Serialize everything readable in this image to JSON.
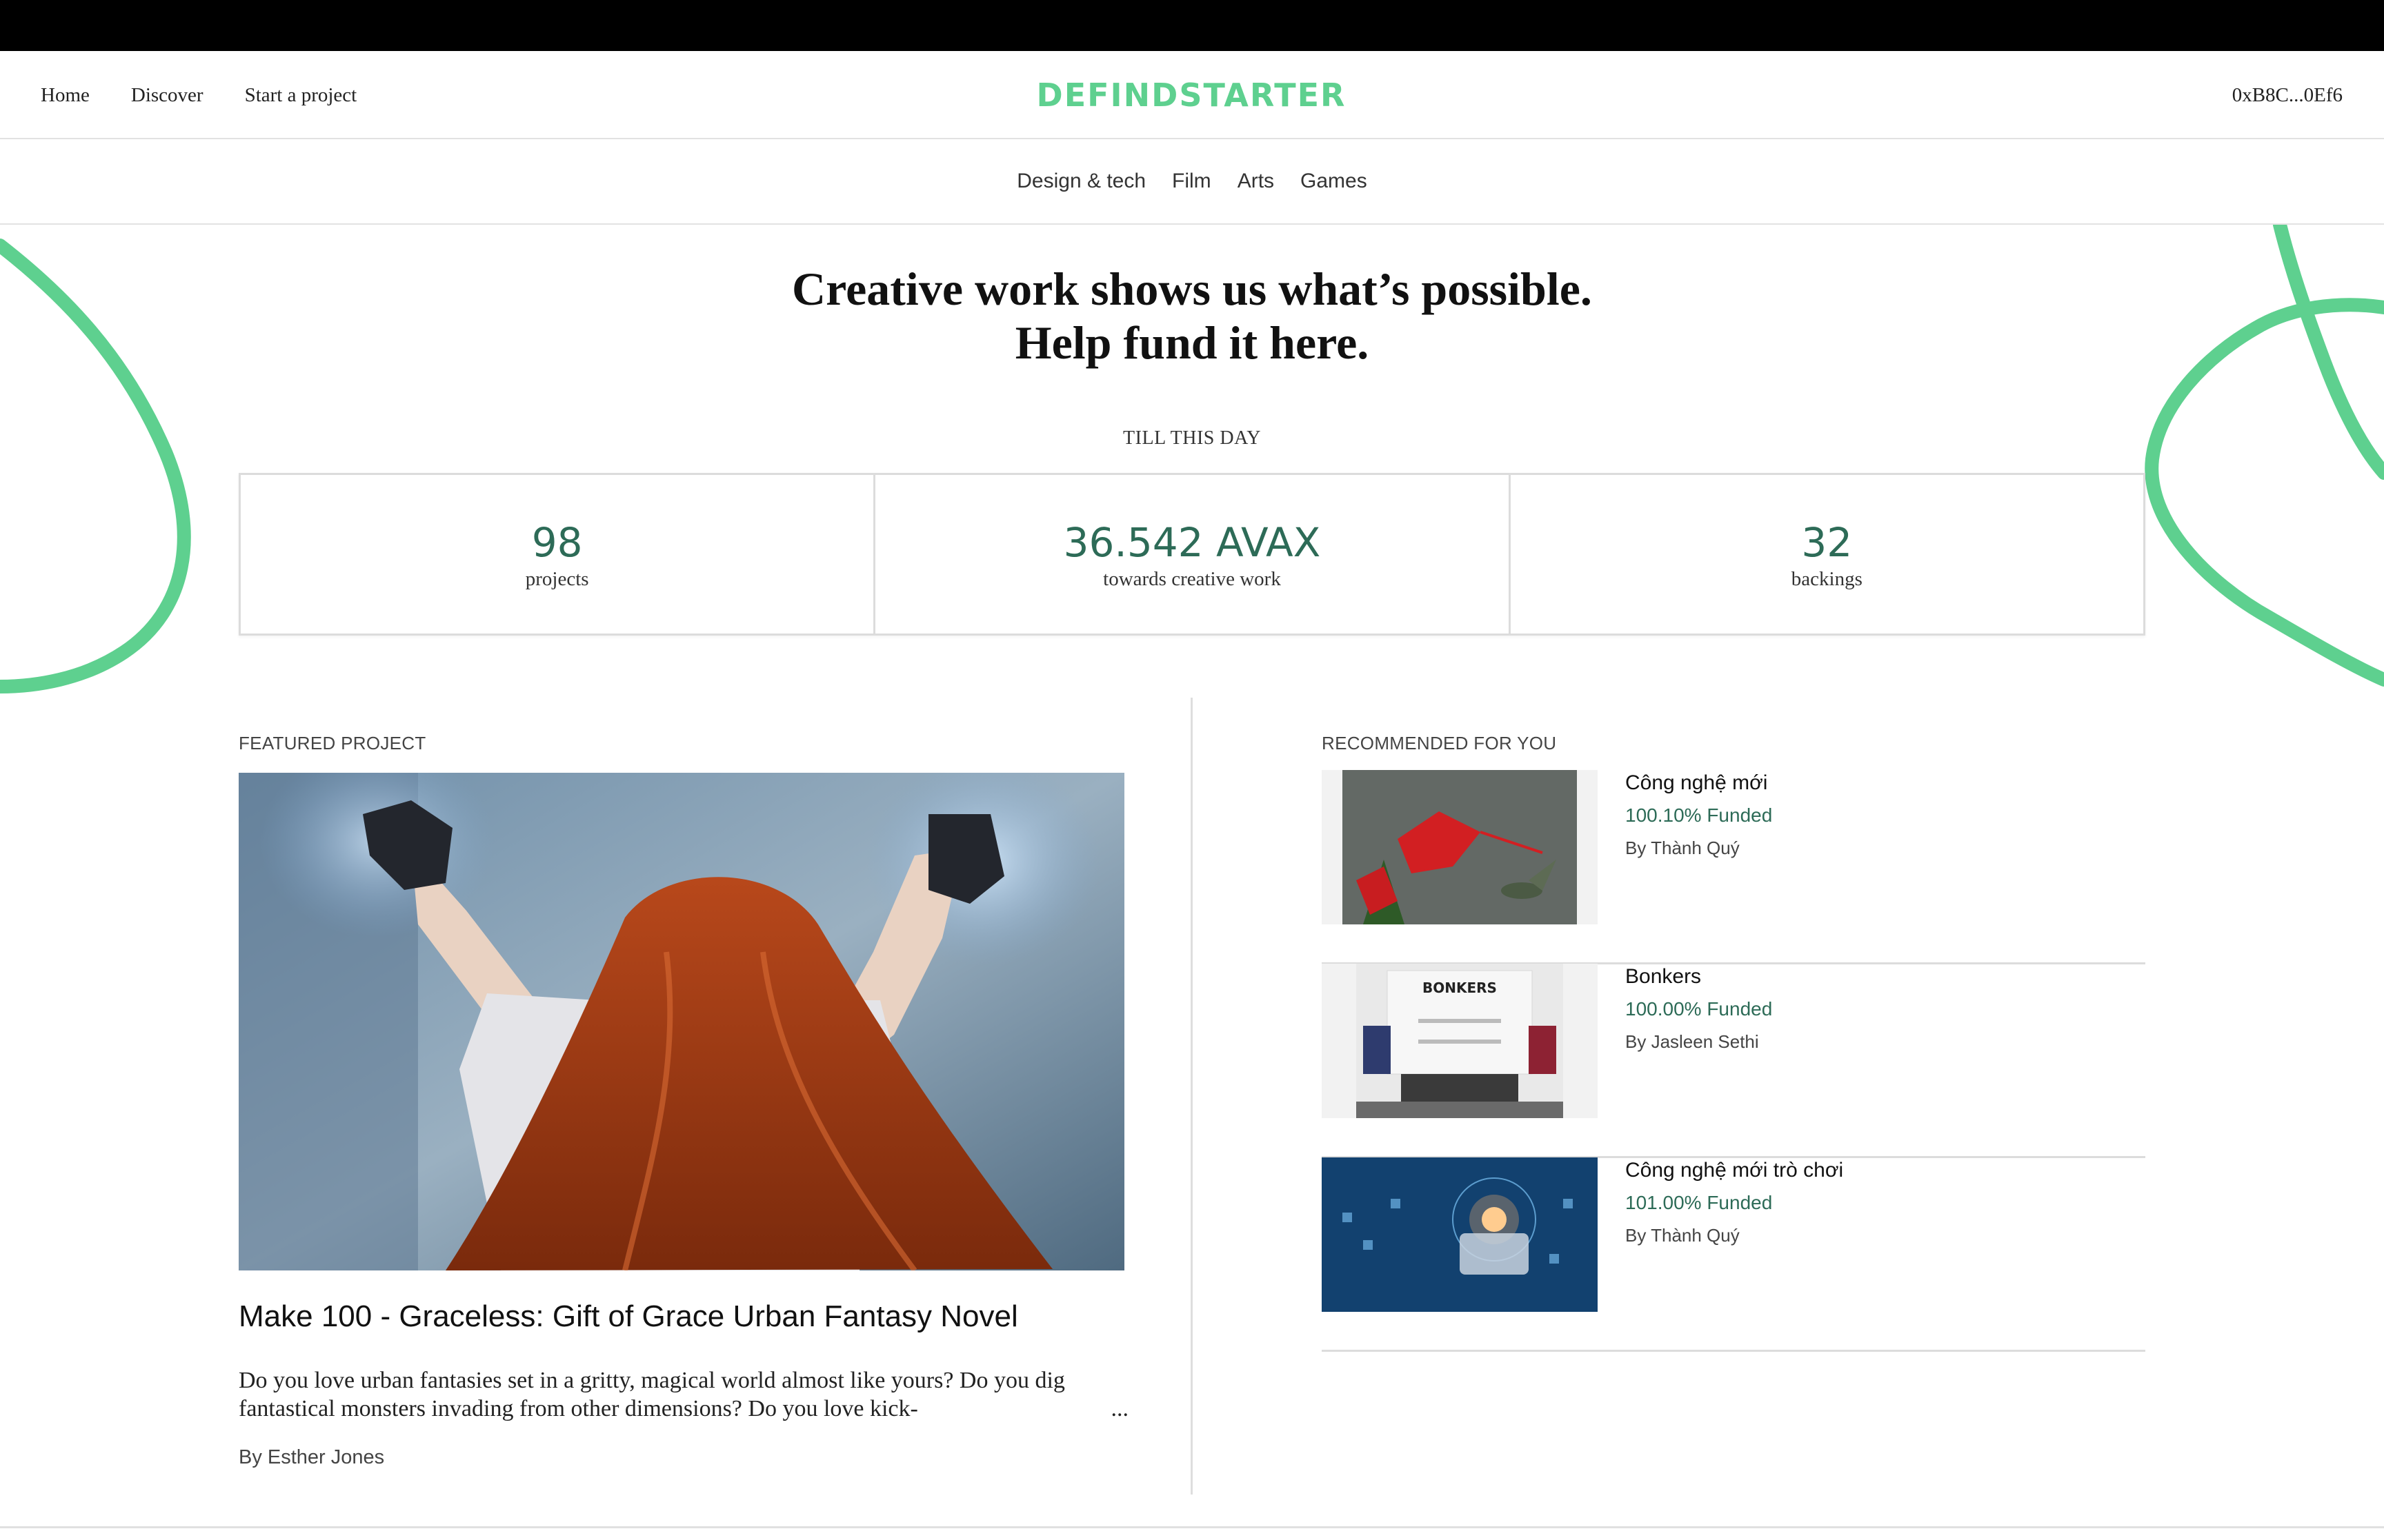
{
  "nav": {
    "links": [
      "Home",
      "Discover",
      "Start a project"
    ],
    "logo": "DEFINDSTARTER",
    "wallet": "0xB8C...0Ef6"
  },
  "categories": [
    "Design & tech",
    "Film",
    "Arts",
    "Games"
  ],
  "hero": {
    "line1": "Creative work shows us what’s possible.",
    "line2": "Help fund it here."
  },
  "stats": {
    "heading": "TILL THIS DAY",
    "items": [
      {
        "value": "98",
        "label": "projects"
      },
      {
        "value": "36.542 AVAX",
        "label": "towards creative work"
      },
      {
        "value": "32",
        "label": "backings"
      }
    ]
  },
  "featured": {
    "label": "FEATURED PROJECT",
    "title": "Make 100 - Graceless: Gift of Grace Urban Fantasy Novel",
    "description": "Do you love urban fantasies set in a gritty, magical world almost like yours? Do you dig fantastical monsters invading from other dimensions? Do you love kick-",
    "ellipsis": "...",
    "author": "By Esther Jones"
  },
  "recommended": {
    "label": "RECOMMENDED FOR YOU",
    "items": [
      {
        "title": "Công nghệ mới",
        "funded": "100.10% Funded",
        "author": "By Thành Quý"
      },
      {
        "title": "Bonkers",
        "funded": "100.00% Funded",
        "author": "By Jasleen Sethi"
      },
      {
        "title": "Công nghệ mới trò chơi",
        "funded": "101.00% Funded",
        "author": "By Thành Quý"
      }
    ],
    "store_sign": "BONKERS"
  },
  "colors": {
    "accent": "#5ed08f",
    "stat_value": "#2d6b57",
    "funded": "#2d6b57"
  }
}
